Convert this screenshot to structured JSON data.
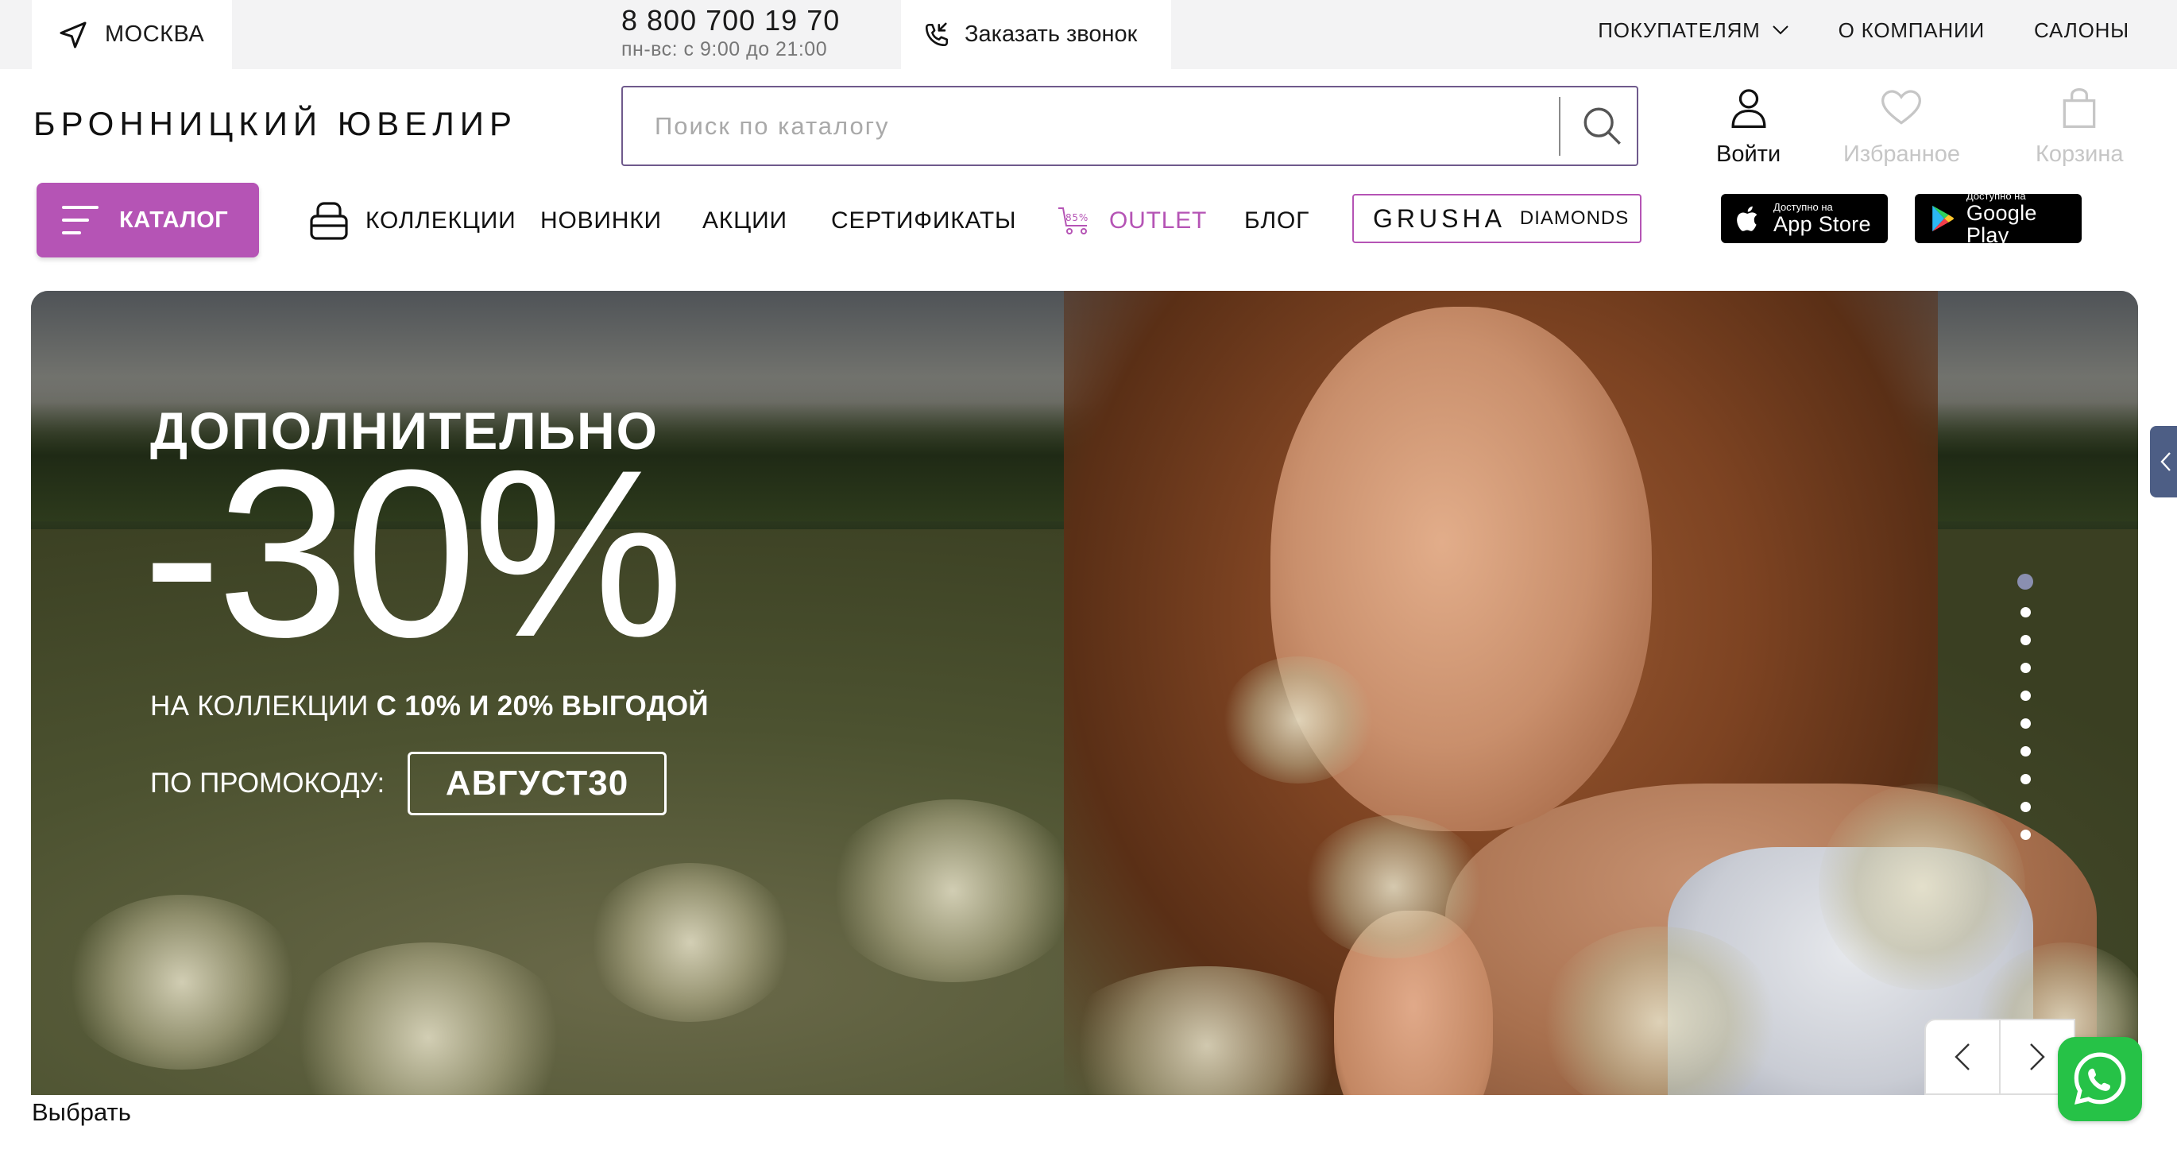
{
  "topbar": {
    "city": "МОСКВА",
    "phone": "8 800 700 19 70",
    "hours": "пн-вс: с 9:00 до 21:00",
    "callback": "Заказать звонок",
    "links": [
      "ПОКУПАТЕЛЯМ",
      "О КОМПАНИИ",
      "САЛОНЫ"
    ]
  },
  "header": {
    "logo": "БРОННИЦКИЙ ЮВЕЛИР",
    "search_placeholder": "Поиск по каталогу",
    "login": "Войти",
    "favorites": "Избранное",
    "cart": "Корзина"
  },
  "nav": {
    "catalog": "КАТАЛОГ",
    "collections": "КОЛЛЕКЦИИ",
    "new": "НОВИНКИ",
    "sales": "АКЦИИ",
    "certificates": "СЕРТИФИКАТЫ",
    "outlet_badge": "85%",
    "outlet": "OUTLET",
    "blog": "БЛОГ",
    "grusha_1": "GRUSHA",
    "grusha_2": "DIAMONDS",
    "appstore_small": "Доступно на",
    "appstore_big": "App Store",
    "googleplay_small": "Доступно на",
    "googleplay_big": "Google Play"
  },
  "hero": {
    "headline": "ДОПОЛНИТЕЛЬНО",
    "discount": "-30%",
    "subtitle_1": "НА КОЛЛЕКЦИИ ",
    "subtitle_2": "С 10% И 20% ВЫГОДОЙ",
    "promo_label": "ПО ПРОМОКОДУ:",
    "promo_code": "АВГУСТ30",
    "slides_total": 10,
    "active_slide": 1
  },
  "footer": {
    "choose": "Выбрать"
  },
  "colors": {
    "accent": "#b554b5",
    "search_border": "#6f5a8c",
    "topbar_bg": "#f3f3f4",
    "whatsapp": "#26c247"
  }
}
